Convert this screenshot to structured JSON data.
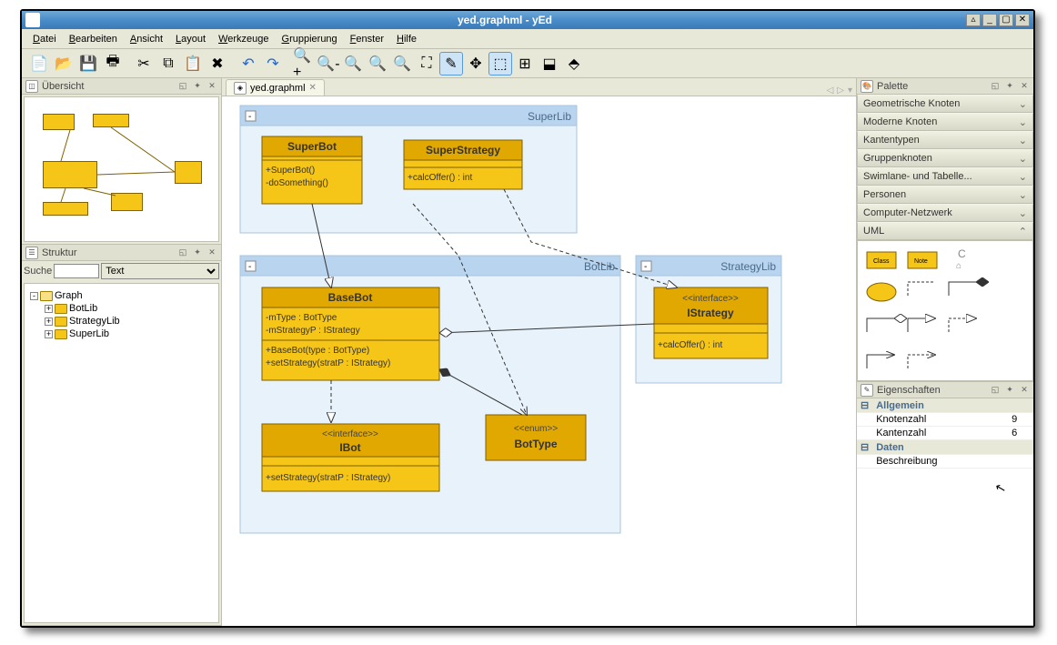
{
  "window": {
    "title": "yed.graphml - yEd"
  },
  "menu": [
    "Datei",
    "Bearbeiten",
    "Ansicht",
    "Layout",
    "Werkzeuge",
    "Gruppierung",
    "Fenster",
    "Hilfe"
  ],
  "panels": {
    "overview": "Übersicht",
    "structure": "Struktur",
    "palette": "Palette",
    "properties": "Eigenschaften"
  },
  "search": {
    "label": "Suche",
    "typeOption": "Text"
  },
  "tree": {
    "root": "Graph",
    "children": [
      "BotLib",
      "StrategyLib",
      "SuperLib"
    ]
  },
  "tab": {
    "name": "yed.graphml"
  },
  "palette_cats": [
    "Geometrische Knoten",
    "Moderne Knoten",
    "Kantentypen",
    "Gruppenknoten",
    "Swimlane- und Tabelle...",
    "Personen",
    "Computer-Netzwerk",
    "UML"
  ],
  "props": {
    "group1": "Allgemein",
    "row1": {
      "k": "Knotenzahl",
      "v": "9"
    },
    "row2": {
      "k": "Kantenzahl",
      "v": "6"
    },
    "group2": "Daten",
    "row3": {
      "k": "Beschreibung",
      "v": ""
    }
  },
  "diagram": {
    "groups": {
      "superlib": "SuperLib",
      "botlib": "BotLib",
      "strategylib": "StrategyLib"
    },
    "classes": {
      "superbot": {
        "name": "SuperBot",
        "ops": [
          "+SuperBot()",
          "-doSomething()"
        ]
      },
      "superstrategy": {
        "name": "SuperStrategy",
        "ops": [
          "+calcOffer() : int"
        ]
      },
      "basebot": {
        "name": "BaseBot",
        "attrs": [
          "-mType : BotType",
          "-mStrategyP : IStrategy"
        ],
        "ops": [
          "+BaseBot(type : BotType)",
          "+setStrategy(stratP : IStrategy)"
        ]
      },
      "ibot": {
        "stereo": "<<interface>>",
        "name": "IBot",
        "ops": [
          "+setStrategy(stratP : IStrategy)"
        ]
      },
      "bottype": {
        "stereo": "<<enum>>",
        "name": "BotType"
      },
      "istrategy": {
        "stereo": "<<interface>>",
        "name": "IStrategy",
        "ops": [
          "+calcOffer() : int"
        ]
      }
    }
  }
}
